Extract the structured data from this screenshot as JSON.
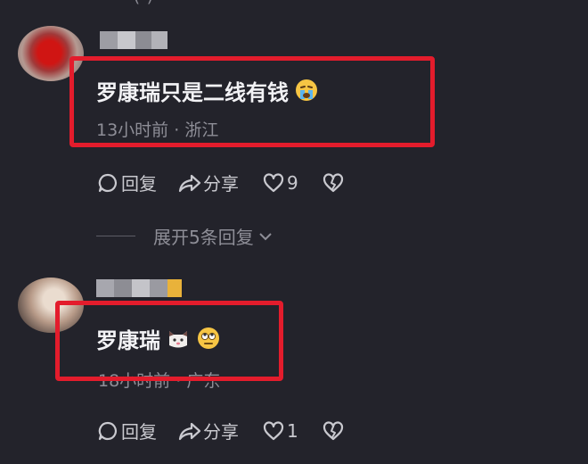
{
  "top_fragment": "( )",
  "comments": [
    {
      "text": "罗康瑞只是二线有钱",
      "emojis": [
        "crying-face"
      ],
      "time": "13小时前",
      "location": "浙江",
      "reply_label": "回复",
      "share_label": "分享",
      "like_count": "9"
    },
    {
      "text": "罗康瑞",
      "emojis": [
        "cat-face",
        "rolling-eyes-face"
      ],
      "time": "18小时前",
      "location": "广东",
      "reply_label": "回复",
      "share_label": "分享",
      "like_count": "1"
    }
  ],
  "expand_replies_label": "展开5条回复",
  "separator": "·",
  "colors": {
    "background": "#23232b",
    "highlight": "#e31c2c",
    "text": "#f2f2f5",
    "muted": "#8e8e97"
  }
}
